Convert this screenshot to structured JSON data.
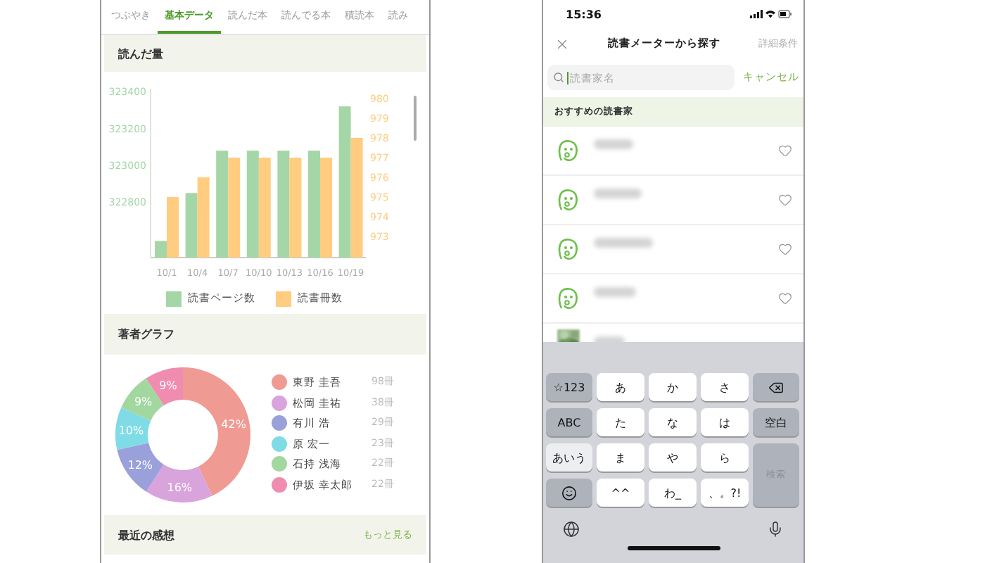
{
  "left_screen": {
    "tabs": [
      {
        "label": "つぶやき",
        "selected": false
      },
      {
        "label": "基本データ",
        "selected": true
      },
      {
        "label": "読んだ本",
        "selected": false
      },
      {
        "label": "読んでる本",
        "selected": false
      },
      {
        "label": "積読本",
        "selected": false
      },
      {
        "label": "読み",
        "selected": false
      }
    ],
    "reading_section": {
      "title": "読んだ量",
      "chart_data": {
        "type": "bar",
        "categories": [
          "10/1",
          "10/4",
          "10/7",
          "10/10",
          "10/13",
          "10/16",
          "10/19"
        ],
        "series": [
          {
            "name": "読書ページ数",
            "color": "#a5d6a7",
            "values": [
              322590,
              322850,
              323080,
              323080,
              323080,
              323080,
              323320
            ]
          },
          {
            "name": "読書冊数",
            "color": "#ffcc80",
            "values": [
              975,
              976,
              977,
              977,
              977,
              977,
              978
            ],
            "axis": "y2"
          }
        ],
        "ylim": [
          322500,
          323416
        ],
        "yticks": [
          322800,
          323000,
          323200,
          323400
        ],
        "y2lim": [
          971.93,
          980.5
        ],
        "y2ticks": [
          973,
          974,
          975,
          976,
          977,
          978,
          979,
          980
        ]
      }
    },
    "author_section": {
      "title": "著者グラフ",
      "chart_data": {
        "type": "donut",
        "values": [
          42,
          16,
          12,
          10,
          9,
          9
        ],
        "value_labels": [
          "42%",
          "16%",
          "12%",
          "10%",
          "9%",
          "9%"
        ],
        "colors": [
          "#ef9a92",
          "#d9a3dc",
          "#9aa0d9",
          "#7fdbe6",
          "#a3d7a0",
          "#f08cb0"
        ]
      },
      "authors": [
        {
          "name": "東野 圭吾",
          "count": "98冊",
          "color": "#ef9a92"
        },
        {
          "name": "松岡 圭祐",
          "count": "38冊",
          "color": "#d9a3dc"
        },
        {
          "name": "有川 浩",
          "count": "29冊",
          "color": "#9aa0d9"
        },
        {
          "name": "原 宏一",
          "count": "23冊",
          "color": "#7fdbe6"
        },
        {
          "name": "石持 浅海",
          "count": "22冊",
          "color": "#a3d7a0"
        },
        {
          "name": "伊坂 幸太郎",
          "count": "22冊",
          "color": "#f08cb0"
        }
      ]
    },
    "impressions_section": {
      "title": "最近の感想",
      "more_link": "もっと見る"
    }
  },
  "right_screen": {
    "status_bar": {
      "time": "15:36"
    },
    "header": {
      "title": "読書メーターから探す",
      "detail_link": "詳細条件",
      "detail_disabled": true
    },
    "search": {
      "placeholder": "読書家名",
      "cancel": "キャンセル"
    },
    "section_title": "おすすめの読書家",
    "readers": [
      {
        "kind": "icon",
        "liked": false
      },
      {
        "kind": "icon",
        "liked": false
      },
      {
        "kind": "icon",
        "liked": false
      },
      {
        "kind": "icon",
        "liked": false
      },
      {
        "kind": "picture"
      }
    ],
    "keyboard": {
      "keys": [
        {
          "kind": "mode",
          "label": "☆123",
          "disabled": false
        },
        {
          "kind": "char",
          "label": "あ",
          "disabled": false
        },
        {
          "kind": "char",
          "label": "か",
          "disabled": false
        },
        {
          "kind": "char",
          "label": "さ",
          "disabled": false
        },
        {
          "kind": "delete",
          "disabled": false
        },
        {
          "kind": "mode",
          "label": "ABC",
          "disabled": false
        },
        {
          "kind": "char",
          "label": "た",
          "disabled": false
        },
        {
          "kind": "char",
          "label": "な",
          "disabled": false
        },
        {
          "kind": "char",
          "label": "は",
          "disabled": false
        },
        {
          "kind": "mode",
          "label": "空白",
          "disabled": false
        },
        {
          "kind": "current",
          "label": "あいう",
          "disabled": false
        },
        {
          "kind": "char",
          "label": "ま",
          "disabled": false
        },
        {
          "kind": "char",
          "label": "や",
          "disabled": false
        },
        {
          "kind": "char",
          "label": "ら",
          "disabled": false
        },
        {
          "kind": "tall",
          "label": "検索",
          "disabled": true
        },
        {
          "kind": "emoji",
          "disabled": false
        },
        {
          "kind": "char",
          "label": "^^",
          "disabled": false
        },
        {
          "kind": "char",
          "label": "わ_",
          "disabled": false
        },
        {
          "kind": "char",
          "label": "、。?!",
          "disabled": false
        }
      ]
    }
  }
}
